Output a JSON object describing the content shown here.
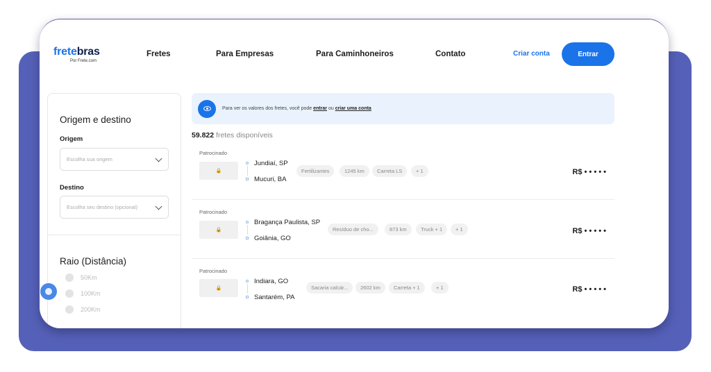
{
  "header": {
    "logo_part1": "frete",
    "logo_part2": "bras",
    "logo_sub": "Por Frete.com",
    "nav": [
      "Fretes",
      "Para Empresas",
      "Para Caminhoneiros",
      "Contato"
    ],
    "criar_conta": "Criar conta",
    "entrar": "Entrar"
  },
  "sidebar": {
    "section_title": "Origem e destino",
    "origem_label": "Origem",
    "origem_placeholder": "Escolha sua origem",
    "destino_label": "Destino",
    "destino_placeholder": "Escolha seu destino (opcional)",
    "raio_title": "Raio (Distância)",
    "radius_options": [
      "50Km",
      "100Km",
      "200Km"
    ]
  },
  "banner": {
    "text": "Para ver os valores dos fretes, você pode",
    "link1": "entrar",
    "mid": "ou",
    "link2": "criar uma conta"
  },
  "results": {
    "count": "59.822",
    "count_suffix": "fretes disponíveis"
  },
  "cards": [
    {
      "sponsored": "Patrocinado",
      "origin": "Jundiaí, SP",
      "destination": "Mucuri, BA",
      "tags": [
        "Fertilizantes",
        "1245 km",
        "Carreta LS",
        "+ 1"
      ],
      "price": "R$ • • • • •"
    },
    {
      "sponsored": "Patrocinado",
      "origin": "Bragança Paulista, SP",
      "destination": "Goiânia, GO",
      "tags": [
        "Resíduo de cho...",
        "873 km",
        "Truck + 1",
        "+ 1"
      ],
      "price": "R$ • • • • •"
    },
    {
      "sponsored": "Patrocinado",
      "origin": "Indiara, GO",
      "destination": "Santarém, PA",
      "tags": [
        "Sacaria calcár...",
        "2602 km",
        "Carreta + 1",
        "+ 1"
      ],
      "price": "R$ • • • • •"
    }
  ],
  "colors": {
    "accent": "#1a73e8",
    "backdrop": "#5561b8",
    "banner_bg": "#eaf3fd"
  },
  "icons": {
    "banner": "eye-icon",
    "lock": "lock-icon",
    "cookie": "cookie-icon",
    "chevron": "chevron-down-icon"
  }
}
